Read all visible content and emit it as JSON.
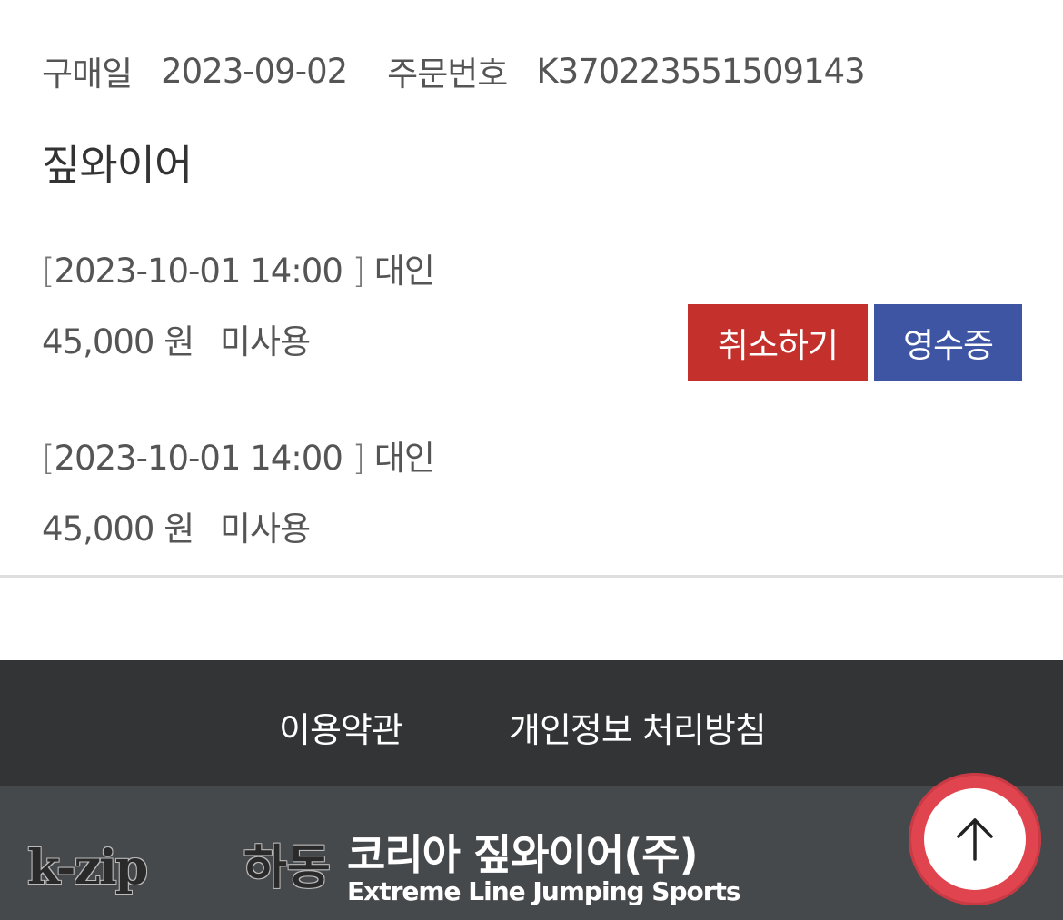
{
  "order": {
    "purchase_date_label": "구매일",
    "purchase_date": "2023-09-02",
    "order_number_label": "주문번호",
    "order_number": "K370223551509143"
  },
  "product_name": "짚와이어",
  "tickets": [
    {
      "bracket_open": "[",
      "datetime": "2023-10-01 14:00",
      "bracket_close": "]",
      "type": "대인",
      "price": "45,000 원",
      "status": "미사용"
    },
    {
      "bracket_open": "[",
      "datetime": "2023-10-01 14:00",
      "bracket_close": "]",
      "type": "대인",
      "price": "45,000 원",
      "status": "미사용"
    }
  ],
  "actions": {
    "cancel_label": "취소하기",
    "receipt_label": "영수증"
  },
  "footer": {
    "terms_label": "이용약관",
    "privacy_label": "개인정보 처리방침",
    "logo_text": "k-zip",
    "region_text": "하동",
    "company_name": "코리아 짚와이어(주)",
    "tagline": "Extreme Line Jumping Sports"
  },
  "icons": {
    "scroll_top": "arrow-up-icon"
  },
  "colors": {
    "cancel": "#c4312c",
    "receipt": "#3d55a2",
    "footer_dark": "#333435",
    "footer_brand": "#46494c",
    "top_button": "#e0454f"
  }
}
